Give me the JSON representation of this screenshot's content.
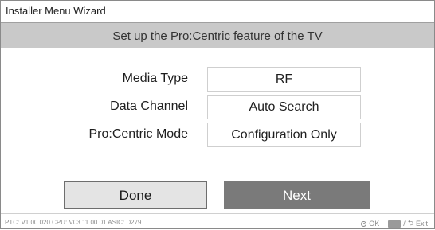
{
  "window": {
    "title": "Installer Menu Wizard",
    "subtitle": "Set up the Pro:Centric feature of the TV"
  },
  "settings": [
    {
      "label": "Media Type",
      "value": "RF"
    },
    {
      "label": "Data Channel",
      "value": "Auto Search"
    },
    {
      "label": "Pro:Centric Mode",
      "value": "Configuration Only"
    }
  ],
  "buttons": {
    "done_label": "Done",
    "next_label": "Next"
  },
  "footer": {
    "version_info": "PTC:  V1.00.020 CPU: V03.11.00.01 ASIC: D279",
    "ok_label": "OK",
    "separator": "/",
    "exit_label": "Exit",
    "ok_icon": "ok-button-icon",
    "back_key_icon": "back-key-icon",
    "back_arrow_icon": "back-arrow-icon"
  },
  "colors": {
    "subtitle_bar": "#c9c9c9",
    "next_button": "#7a7a7a",
    "done_button": "#e4e4e4"
  }
}
